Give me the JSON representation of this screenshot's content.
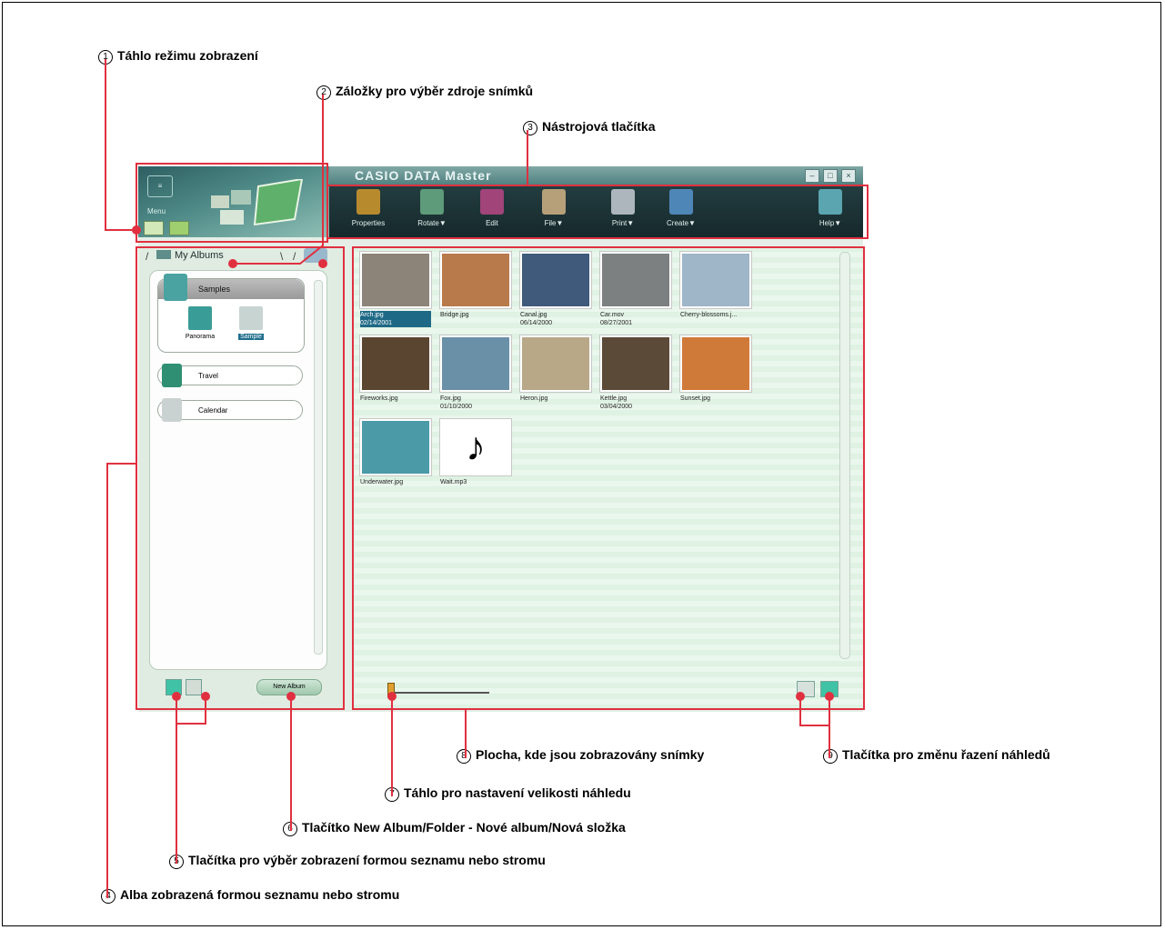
{
  "callouts": {
    "c1": {
      "num": "1",
      "text": "Táhlo režimu zobrazení"
    },
    "c2": {
      "num": "2",
      "text": "Záložky pro výběr zdroje snímků"
    },
    "c3": {
      "num": "3",
      "text": "Nástrojová tlačítka"
    },
    "c4": {
      "num": "4",
      "text": "Alba zobrazená formou seznamu nebo stromu"
    },
    "c5": {
      "num": "5",
      "text": "Tlačítka pro výběr zobrazení formou seznamu nebo stromu"
    },
    "c6": {
      "num": "6",
      "text": "Tlačítko New Album/Folder - Nové album/Nová složka"
    },
    "c7": {
      "num": "7",
      "text": "Táhlo pro nastavení velikosti náhledu"
    },
    "c8": {
      "num": "8",
      "text": "Plocha, kde jsou zobrazovány snímky"
    },
    "c9": {
      "num": "9",
      "text": "Tlačítka pro změnu řazení náhledů"
    }
  },
  "app": {
    "title": "CASIO DATA Master",
    "menu_label": "Menu",
    "toolbar": [
      {
        "label": "Properties",
        "icon": "properties-icon",
        "color": "#b88a2e"
      },
      {
        "label": "Rotate▼",
        "icon": "rotate-icon",
        "color": "#5d9b7a"
      },
      {
        "label": "Edit",
        "icon": "edit-icon",
        "color": "#a0447a"
      },
      {
        "label": "File▼",
        "icon": "file-icon",
        "color": "#b5a07a"
      },
      {
        "label": "Print▼",
        "icon": "print-icon",
        "color": "#aeb6bd"
      },
      {
        "label": "Create▼",
        "icon": "create-icon",
        "color": "#4f86b8"
      },
      {
        "label": "Help▼",
        "icon": "help-icon",
        "color": "#5aa5b0"
      }
    ],
    "source_tab": "My Albums",
    "album_group": {
      "title": "Samples",
      "items": [
        "Panorama",
        "Sample"
      ]
    },
    "albums": [
      "Travel",
      "Calendar"
    ],
    "new_album_label": "New Album",
    "thumbnails": [
      {
        "name": "Arch.jpg",
        "date": "02/14/2001",
        "color": "#8c8478",
        "selected": true
      },
      {
        "name": "Bridge.jpg",
        "date": "",
        "color": "#b87a4a"
      },
      {
        "name": "Canal.jpg",
        "date": "06/14/2000",
        "color": "#3f5a7a"
      },
      {
        "name": "Car.mov",
        "date": "08/27/2001",
        "color": "#7c8080"
      },
      {
        "name": "Cherry-blossoms.j...",
        "date": "",
        "color": "#9fb5c8"
      },
      {
        "name": "Fireworks.jpg",
        "date": "",
        "color": "#5a4630"
      },
      {
        "name": "Fox.jpg",
        "date": "01/10/2000",
        "color": "#6a90a8"
      },
      {
        "name": "Heron.jpg",
        "date": "",
        "color": "#b8a888"
      },
      {
        "name": "Kettle.jpg",
        "date": "03/04/2000",
        "color": "#5c4a38"
      },
      {
        "name": "Sunset.jpg",
        "date": "",
        "color": "#d07a3a"
      },
      {
        "name": "Underwater.jpg",
        "date": "",
        "color": "#4a9aa8"
      },
      {
        "name": "Wait.mp3",
        "date": "",
        "color": "#ffffff"
      }
    ]
  },
  "colors": {
    "callout_line": "#e03040",
    "toolbar_bg": "#1c3336",
    "title_bg": "#5f8d8b"
  }
}
